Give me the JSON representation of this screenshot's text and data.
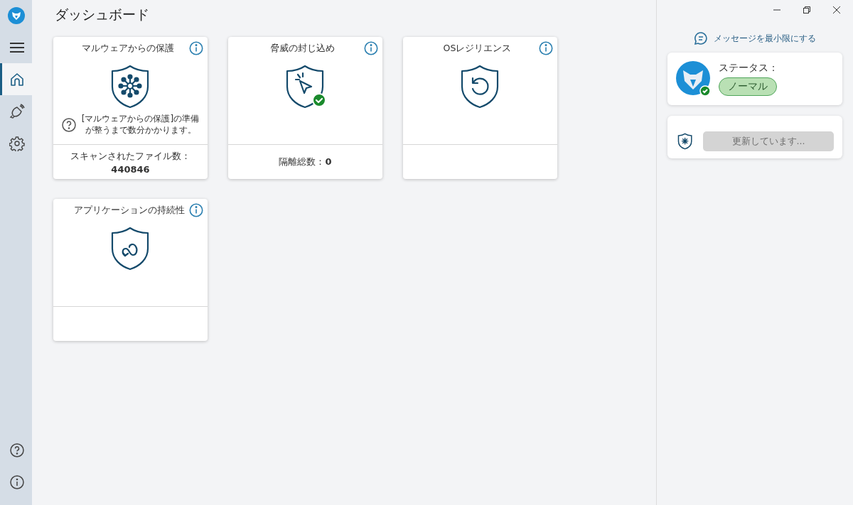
{
  "sidebar": {
    "items": [
      {
        "kind": "menu",
        "selected": false
      },
      {
        "kind": "home",
        "selected": true
      },
      {
        "kind": "alerts",
        "selected": false
      },
      {
        "kind": "settings",
        "selected": false
      }
    ],
    "bottom_items": [
      {
        "kind": "help",
        "selected": false
      },
      {
        "kind": "info",
        "selected": false
      }
    ]
  },
  "page_title": "ダッシュボード",
  "cards": [
    {
      "title": "マルウェアからの保護",
      "kind": "network",
      "checked": false,
      "note": "[マルウェアからの保護]の準備が整うまで数分かかります。",
      "footer": {
        "label": "スキャンされたファイル数：",
        "value": "440846",
        "stacked": true
      }
    },
    {
      "title": "脅威の封じ込め",
      "kind": "cursor",
      "checked": true,
      "footer": {
        "label": "隔離総数：",
        "value": "0",
        "stacked": false
      }
    },
    {
      "title": "OSレジリエンス",
      "kind": "restore",
      "checked": false
    },
    {
      "title": "アプリケーションの持続性",
      "kind": "loop",
      "checked": false
    }
  ],
  "right_panel": {
    "message_link": "メッセージを最小限にする",
    "status": {
      "label": "ステータス：",
      "value": "ノーマル",
      "ok": true
    },
    "update": {
      "button": "更新しています...",
      "disabled": true
    }
  }
}
